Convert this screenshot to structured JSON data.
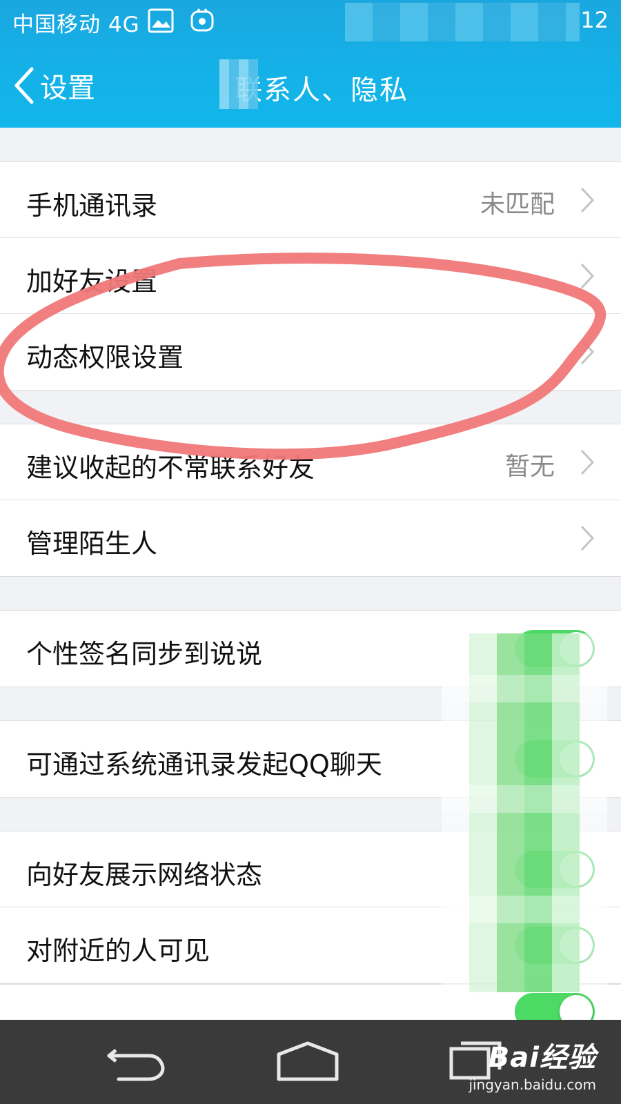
{
  "status_bar": {
    "carrier": "中国移动 4G",
    "time_fragment": "12",
    "icons": [
      "image-icon",
      "app-notification-icon"
    ]
  },
  "nav": {
    "back_label": "设置",
    "title": "联系人、隐私"
  },
  "groups": [
    {
      "rows": [
        {
          "label": "手机通讯录",
          "value": "未匹配",
          "chevron": true
        },
        {
          "label": "加好友设置",
          "value": "",
          "chevron": true
        },
        {
          "label": "动态权限设置",
          "value": "",
          "chevron": true
        }
      ]
    },
    {
      "rows": [
        {
          "label": "建议收起的不常联系好友",
          "value": "暂无",
          "chevron": true
        },
        {
          "label": "管理陌生人",
          "value": "",
          "chevron": true
        }
      ]
    },
    {
      "rows": [
        {
          "label": "个性签名同步到说说",
          "toggle": "on"
        }
      ]
    },
    {
      "rows": [
        {
          "label": "可通过系统通讯录发起QQ聊天",
          "toggle": "on"
        }
      ]
    },
    {
      "rows": [
        {
          "label": "向好友展示网络状态",
          "toggle": "on"
        },
        {
          "label": "对附近的人可见",
          "toggle": "on"
        }
      ]
    }
  ],
  "watermark": {
    "logo": "Bai经验",
    "url": "jingyan.baidu.com"
  },
  "colors": {
    "nav_blue": "#14b1e7",
    "toggle_green": "#4cd964",
    "annotation_red": "#f07878",
    "system_nav": "#3a3a3a"
  }
}
